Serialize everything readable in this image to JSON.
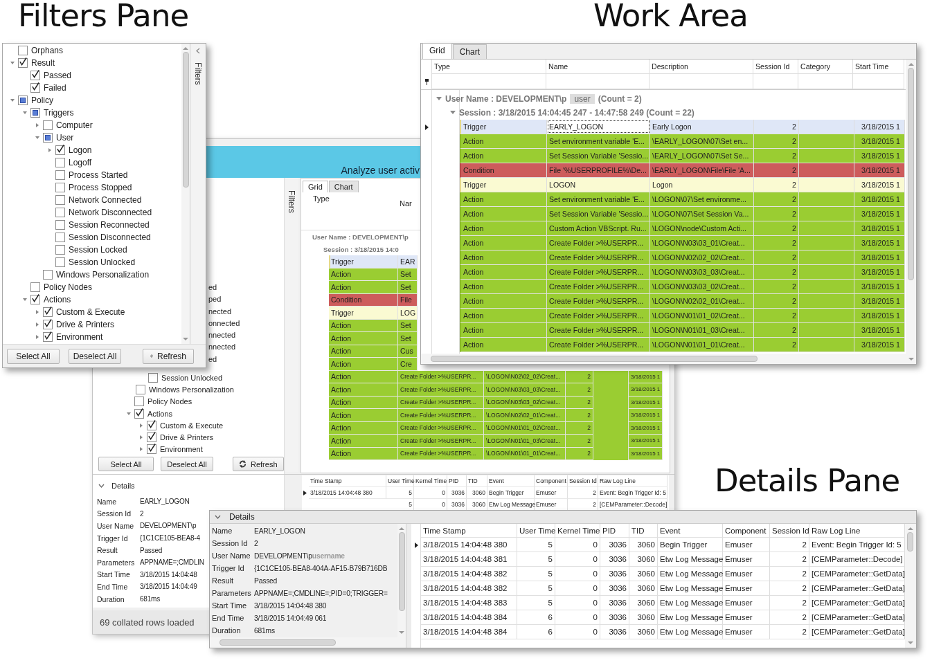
{
  "headings": [
    "Filters Pane",
    "Work Area",
    "Details Pane"
  ],
  "background_window": {
    "title": "Analyze user activ",
    "filters_label": "Filters",
    "tree_fragments": [
      "ed",
      "ped",
      "nected",
      "onnected",
      "nnected",
      "nnected",
      "ed"
    ],
    "tree_items": [
      {
        "label": "Session Unlocked",
        "checked": false,
        "mixed": false
      },
      {
        "label": "Windows Personalization",
        "checked": false,
        "mixed": false
      },
      {
        "label": "Policy Nodes",
        "checked": false,
        "mixed": false
      },
      {
        "label": "Actions",
        "checked": true,
        "mixed": false,
        "expanded": true,
        "children": [
          {
            "label": "Custom & Execute",
            "checked": true,
            "mixed": false,
            "expanded": false
          },
          {
            "label": "Drive & Printers",
            "checked": true,
            "mixed": false,
            "expanded": false
          },
          {
            "label": "Environment",
            "checked": true,
            "mixed": false,
            "expanded": false
          }
        ]
      }
    ],
    "buttons": [
      {
        "kind": "plain",
        "label": "Select All"
      },
      {
        "kind": "plain",
        "label": "Deselect All"
      },
      {
        "kind": "refresh",
        "label": "Refresh"
      }
    ],
    "tabs": [
      {
        "label": "Grid",
        "selected": true
      },
      {
        "label": "Chart",
        "selected": false
      }
    ],
    "columns": [
      "Type",
      "Nar"
    ],
    "group": "User Name : DEVELOPMENT\\p",
    "session": "Session : 3/18/2015 14:0",
    "rows": [
      {
        "kind": "trigger",
        "selected": true,
        "type": "Trigger",
        "name": "EAR"
      },
      {
        "kind": "action",
        "selected": false,
        "type": "Action",
        "name": "Set"
      },
      {
        "kind": "action",
        "selected": false,
        "type": "Action",
        "name": "Set"
      },
      {
        "kind": "condition",
        "selected": false,
        "type": "Condition",
        "name": "File"
      },
      {
        "kind": "trigger",
        "selected": false,
        "type": "Trigger",
        "name": "LOG"
      },
      {
        "kind": "action",
        "selected": false,
        "type": "Action",
        "name": "Set"
      },
      {
        "kind": "action",
        "selected": false,
        "type": "Action",
        "name": "Set"
      },
      {
        "kind": "action",
        "selected": false,
        "type": "Action",
        "name": "Cus"
      },
      {
        "kind": "action",
        "selected": false,
        "type": "Action",
        "name": "Cre"
      },
      {
        "kind": "action",
        "selected": false,
        "type": "Action",
        "name": "Create Folder >%USERPR...",
        "description": "\\LOGON\\N02\\02_02\\Creat...",
        "session_id": "2",
        "start_time": "3/18/2015 1"
      },
      {
        "kind": "action",
        "selected": false,
        "type": "Action",
        "name": "Create Folder >%USERPR...",
        "description": "\\LOGON\\N03\\03_03\\Creat...",
        "session_id": "2",
        "start_time": "3/18/2015 1"
      },
      {
        "kind": "action",
        "selected": false,
        "type": "Action",
        "name": "Create Folder >%USERPR...",
        "description": "\\LOGON\\N03\\03_02\\Creat...",
        "session_id": "2",
        "start_time": "3/18/2015 1"
      },
      {
        "kind": "action",
        "selected": false,
        "type": "Action",
        "name": "Create Folder >%USERPR...",
        "description": "\\LOGON\\N02\\02_01\\Creat...",
        "session_id": "2",
        "start_time": "3/18/2015 1"
      },
      {
        "kind": "action",
        "selected": false,
        "type": "Action",
        "name": "Create Folder >%USERPR...",
        "description": "\\LOGON\\N01\\01_02\\Creat...",
        "session_id": "2",
        "start_time": "3/18/2015 1"
      },
      {
        "kind": "action",
        "selected": false,
        "type": "Action",
        "name": "Create Folder >%USERPR...",
        "description": "\\LOGON\\N01\\01_03\\Creat...",
        "session_id": "2",
        "start_time": "3/18/2015 1"
      },
      {
        "kind": "action",
        "selected": false,
        "type": "Action",
        "name": "Create Folder >%USERPR...",
        "description": "\\LOGON\\N01\\01_01\\Creat...",
        "session_id": "2",
        "start_time": "3/18/2015 1"
      }
    ],
    "details": {
      "title": "Details",
      "properties": [
        {
          "label": "Name",
          "value": "EARLY_LOGON"
        },
        {
          "label": "Session Id",
          "value": "2"
        },
        {
          "label": "User Name",
          "value": "DEVELOPMENT\\p"
        },
        {
          "label": "Trigger Id",
          "value": "{1C1CE105-BEA8-4"
        },
        {
          "label": "Result",
          "value": "Passed"
        },
        {
          "label": "Parameters",
          "value": "APPNAME=;CMDLIN"
        },
        {
          "label": "Start Time",
          "value": "3/18/2015 14:04:48"
        },
        {
          "label": "End Time",
          "value": "3/18/2015 14:04:49"
        },
        {
          "label": "Duration",
          "value": "681ms"
        }
      ],
      "columns": [
        "Time Stamp",
        "User Time",
        "Kernel Time",
        "PID",
        "TID",
        "Event",
        "Component",
        "Session Id",
        "Raw Log Line"
      ],
      "rows": [
        {
          "selected": true,
          "cells": [
            "3/18/2015 14:04:48 380",
            "5",
            "0",
            "3036",
            "3060",
            "Begin Trigger",
            "Emuser",
            "2",
            "Event: Begin Trigger Id: 5"
          ]
        },
        {
          "selected": false,
          "cells": [
            null,
            "5",
            "0",
            "3036",
            "3060",
            "Etw Log Message",
            "Emuser",
            "2",
            "[CEMParameter::Decode]"
          ]
        }
      ]
    },
    "status": "69 collated rows loaded"
  },
  "filters": {
    "side_label": "Filters",
    "items": [
      {
        "label": "Orphans",
        "checked": false,
        "mixed": false
      },
      {
        "label": "Result",
        "checked": true,
        "mixed": false,
        "expanded": true,
        "children": [
          {
            "label": "Passed",
            "checked": true,
            "mixed": false
          },
          {
            "label": "Failed",
            "checked": true,
            "mixed": false
          }
        ]
      },
      {
        "label": "Policy",
        "checked": false,
        "mixed": true,
        "expanded": true,
        "children": [
          {
            "label": "Triggers",
            "checked": false,
            "mixed": true,
            "expanded": true,
            "children": [
              {
                "label": "Computer",
                "checked": false,
                "mixed": false,
                "expanded": false
              },
              {
                "label": "User",
                "checked": false,
                "mixed": true,
                "expanded": true,
                "children": [
                  {
                    "label": "Logon",
                    "checked": true,
                    "mixed": false,
                    "expanded": false
                  },
                  {
                    "label": "Logoff",
                    "checked": false,
                    "mixed": false
                  },
                  {
                    "label": "Process Started",
                    "checked": false,
                    "mixed": false
                  },
                  {
                    "label": "Process Stopped",
                    "checked": false,
                    "mixed": false
                  },
                  {
                    "label": "Network Connected",
                    "checked": false,
                    "mixed": false
                  },
                  {
                    "label": "Network Disconnected",
                    "checked": false,
                    "mixed": false
                  },
                  {
                    "label": "Session Reconnected",
                    "checked": false,
                    "mixed": false
                  },
                  {
                    "label": "Session Disconnected",
                    "checked": false,
                    "mixed": false
                  },
                  {
                    "label": "Session Locked",
                    "checked": false,
                    "mixed": false
                  },
                  {
                    "label": "Session Unlocked",
                    "checked": false,
                    "mixed": false
                  }
                ]
              },
              {
                "label": "Windows Personalization",
                "checked": false,
                "mixed": false
              }
            ]
          },
          {
            "label": "Policy Nodes",
            "checked": false,
            "mixed": false
          },
          {
            "label": "Actions",
            "checked": true,
            "mixed": false,
            "expanded": true,
            "children": [
              {
                "label": "Custom & Execute",
                "checked": true,
                "mixed": false,
                "expanded": false
              },
              {
                "label": "Drive & Printers",
                "checked": true,
                "mixed": false,
                "expanded": false
              },
              {
                "label": "Environment",
                "checked": true,
                "mixed": false,
                "expanded": false
              }
            ]
          }
        ]
      }
    ],
    "buttons": [
      {
        "kind": "plain",
        "label": "Select All"
      },
      {
        "kind": "plain",
        "label": "Deselect All"
      },
      {
        "kind": "refresh",
        "label": "Refresh"
      }
    ]
  },
  "work_area": {
    "tabs": [
      {
        "label": "Grid",
        "selected": true
      },
      {
        "label": "Chart",
        "selected": false
      }
    ],
    "columns": [
      "Type",
      "Name",
      "Description",
      "Session Id",
      "Category",
      "Start Time"
    ],
    "group": {
      "label": "User Name : DEVELOPMENT\\p",
      "masked": "user",
      "count": "(Count = 2)"
    },
    "session": "Session : 3/18/2015 14:04:45 247 - 14:47:58 249 (Count = 22)",
    "rows": [
      {
        "kind": "trigger",
        "selected": true,
        "type": "Trigger",
        "name": "EARLY_LOGON",
        "description": "Early Logon",
        "session_id": "2",
        "start_time": "3/18/2015 1"
      },
      {
        "kind": "action",
        "selected": false,
        "type": "Action",
        "name": "Set environment variable 'E...",
        "description": "\\EARLY_LOGON\\07\\Set en...",
        "session_id": "2",
        "start_time": "3/18/2015 1"
      },
      {
        "kind": "action",
        "selected": false,
        "type": "Action",
        "name": "Set Session Variable 'Sessio...",
        "description": "\\EARLY_LOGON\\07\\Set Se...",
        "session_id": "2",
        "start_time": "3/18/2015 1"
      },
      {
        "kind": "condition",
        "selected": false,
        "type": "Condition",
        "name": "File '%USERPROFILE%\\De...",
        "description": "\\EARLY_LOGON\\File\\File 'A...",
        "session_id": "2",
        "start_time": "3/18/2015 1"
      },
      {
        "kind": "trigger",
        "selected": false,
        "type": "Trigger",
        "name": "LOGON",
        "description": "Logon",
        "session_id": "2",
        "start_time": "3/18/2015 1"
      },
      {
        "kind": "action",
        "selected": false,
        "type": "Action",
        "name": "Set environment variable 'E...",
        "description": "\\LOGON\\07\\Set environme...",
        "session_id": "2",
        "start_time": "3/18/2015 1"
      },
      {
        "kind": "action",
        "selected": false,
        "type": "Action",
        "name": "Set Session Variable 'Sessio...",
        "description": "\\LOGON\\07\\Set Session Va...",
        "session_id": "2",
        "start_time": "3/18/2015 1"
      },
      {
        "kind": "action",
        "selected": false,
        "type": "Action",
        "name": "Custom Action VBScript. Ru...",
        "description": "\\LOGON\\node\\Custom Acti...",
        "session_id": "2",
        "start_time": "3/18/2015 1"
      },
      {
        "kind": "action",
        "selected": false,
        "type": "Action",
        "name": "Create Folder >%USERPR...",
        "description": "\\LOGON\\N03\\03_01\\Creat...",
        "session_id": "2",
        "start_time": "3/18/2015 1"
      },
      {
        "kind": "action",
        "selected": false,
        "type": "Action",
        "name": "Create Folder >%USERPR...",
        "description": "\\LOGON\\N02\\02_02\\Creat...",
        "session_id": "2",
        "start_time": "3/18/2015 1"
      },
      {
        "kind": "action",
        "selected": false,
        "type": "Action",
        "name": "Create Folder >%USERPR...",
        "description": "\\LOGON\\N03\\03_03\\Creat...",
        "session_id": "2",
        "start_time": "3/18/2015 1"
      },
      {
        "kind": "action",
        "selected": false,
        "type": "Action",
        "name": "Create Folder >%USERPR...",
        "description": "\\LOGON\\N03\\03_02\\Creat...",
        "session_id": "2",
        "start_time": "3/18/2015 1"
      },
      {
        "kind": "action",
        "selected": false,
        "type": "Action",
        "name": "Create Folder >%USERPR...",
        "description": "\\LOGON\\N02\\02_01\\Creat...",
        "session_id": "2",
        "start_time": "3/18/2015 1"
      },
      {
        "kind": "action",
        "selected": false,
        "type": "Action",
        "name": "Create Folder >%USERPR...",
        "description": "\\LOGON\\N01\\01_02\\Creat...",
        "session_id": "2",
        "start_time": "3/18/2015 1"
      },
      {
        "kind": "action",
        "selected": false,
        "type": "Action",
        "name": "Create Folder >%USERPR...",
        "description": "\\LOGON\\N01\\01_03\\Creat...",
        "session_id": "2",
        "start_time": "3/18/2015 1"
      },
      {
        "kind": "action",
        "selected": false,
        "type": "Action",
        "name": "Create Folder >%USERPR...",
        "description": "\\LOGON\\N01\\01_01\\Creat...",
        "session_id": "2",
        "start_time": "3/18/2015 1"
      }
    ]
  },
  "details_pane": {
    "title": "Details",
    "properties": [
      {
        "label": "Name",
        "value": "EARLY_LOGON"
      },
      {
        "label": "Session Id",
        "value": "2"
      },
      {
        "label": "User Name",
        "value": "DEVELOPMENT\\p",
        "masked": "username"
      },
      {
        "label": "Trigger Id",
        "value": "{1C1CE105-BEA8-404A-AF15-B79B716DB"
      },
      {
        "label": "Result",
        "value": "Passed"
      },
      {
        "label": "Parameters",
        "value": "APPNAME=;CMDLINE=;PID=0;TRIGGER="
      },
      {
        "label": "Start Time",
        "value": "3/18/2015 14:04:48 380"
      },
      {
        "label": "End Time",
        "value": "3/18/2015 14:04:49 061"
      },
      {
        "label": "Duration",
        "value": "681ms"
      }
    ],
    "columns": [
      "Time Stamp",
      "User Time",
      "Kernel Time",
      "PID",
      "TID",
      "Event",
      "Component",
      "Session Id",
      "Raw Log Line"
    ],
    "rows": [
      {
        "selected": true,
        "cells": [
          "3/18/2015 14:04:48 380",
          "5",
          "0",
          "3036",
          "3060",
          "Begin Trigger",
          "Emuser",
          "2",
          "Event: Begin Trigger Id: 5"
        ]
      },
      {
        "selected": false,
        "cells": [
          "3/18/2015 14:04:48 381",
          "5",
          "0",
          "3036",
          "3060",
          "Etw Log Message",
          "Emuser",
          "2",
          "[CEMParameter::Decode]"
        ]
      },
      {
        "selected": false,
        "cells": [
          "3/18/2015 14:04:48 382",
          "5",
          "0",
          "3036",
          "3060",
          "Etw Log Message",
          "Emuser",
          "2",
          "[CEMParameter::GetData]"
        ]
      },
      {
        "selected": false,
        "cells": [
          "3/18/2015 14:04:48 382",
          "5",
          "0",
          "3036",
          "3060",
          "Etw Log Message",
          "Emuser",
          "2",
          "[CEMParameter::GetData]"
        ]
      },
      {
        "selected": false,
        "cells": [
          "3/18/2015 14:04:48 383",
          "5",
          "0",
          "3036",
          "3060",
          "Etw Log Message",
          "Emuser",
          "2",
          "[CEMParameter::GetData]"
        ]
      },
      {
        "selected": false,
        "cells": [
          "3/18/2015 14:04:48 384",
          "6",
          "0",
          "3036",
          "3060",
          "Etw Log Message",
          "Emuser",
          "2",
          "[CEMParameter::GetData]"
        ]
      },
      {
        "selected": false,
        "cells": [
          "3/18/2015 14:04:48 384",
          "6",
          "0",
          "3036",
          "3060",
          "Etw Log Message",
          "Emuser",
          "2",
          "[CEMParameter::GetData]"
        ]
      }
    ]
  }
}
